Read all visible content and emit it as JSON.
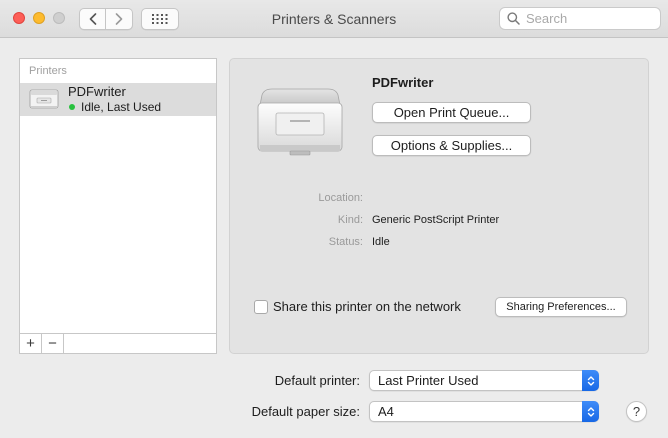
{
  "window": {
    "title": "Printers & Scanners"
  },
  "search": {
    "placeholder": "Search",
    "value": ""
  },
  "printers_list": {
    "header": "Printers",
    "items": [
      {
        "name": "PDFwriter",
        "status": "Idle, Last Used",
        "status_color": "#27c13e"
      }
    ],
    "add_label": "+",
    "remove_label": "−"
  },
  "detail": {
    "name": "PDFwriter",
    "open_queue_label": "Open Print Queue...",
    "options_label": "Options & Supplies...",
    "location_label": "Location:",
    "location_value": "",
    "kind_label": "Kind:",
    "kind_value": "Generic PostScript Printer",
    "status_label": "Status:",
    "status_value": "Idle",
    "share_label": "Share this printer on the network",
    "share_checked": false,
    "sharing_prefs_label": "Sharing Preferences..."
  },
  "defaults": {
    "printer_label": "Default printer:",
    "printer_value": "Last Printer Used",
    "paper_label": "Default paper size:",
    "paper_value": "A4"
  },
  "help_label": "?",
  "colors": {
    "accent": "#1768e6",
    "window_bg": "#ececec"
  }
}
